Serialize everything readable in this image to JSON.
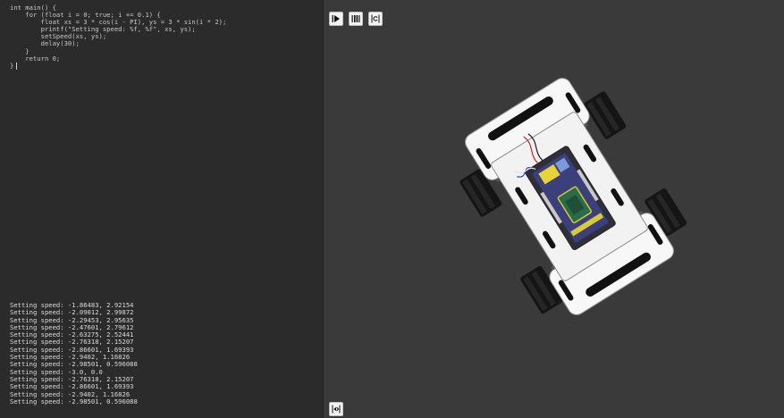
{
  "editor": {
    "code_lines": [
      "int main() {",
      "    for (float i = 0; true; i += 0.1) {",
      "        float xs = 3 * cos(i - PI), ys = 3 * sin(i * 2);",
      "        printf(\"Setting speed: %f, %f\", xs, ys);",
      "        setSpeed(xs, ys);",
      "        delay(30);",
      "    }",
      "    return 0;"
    ],
    "cursor_line": "}"
  },
  "console": {
    "lines": [
      "Setting speed: -1.86483, 2.92154",
      "Setting speed: -2.09012, 2.99872",
      "Setting speed: -2.29453, 2.95635",
      "Setting speed: -2.47601, 2.79612",
      "Setting speed: -2.63275, 2.52441",
      "Setting speed: -2.76318, 2.15207",
      "Setting speed: -2.86601, 1.69393",
      "Setting speed: -2.9402, 1.16826",
      "Setting speed: -2.98501, 0.596088",
      "Setting speed: -3.0, 0.0",
      "Setting speed: -2.76318, 2.15207",
      "Setting speed: -2.86601, 1.69393",
      "Setting speed: -2.9402, 1.16826",
      "Setting speed: -2.98501, 0.596088"
    ]
  },
  "toolbar": {
    "buttons": [
      {
        "icon": "play-icon"
      },
      {
        "icon": "pause-icon"
      },
      {
        "icon": "reset-icon"
      }
    ]
  },
  "bottom_toolbar": {
    "buttons": [
      {
        "icon": "view-code-icon"
      }
    ]
  },
  "colors": {
    "editor_bg": "#2b2b2b",
    "sim_bg": "#3a3a3a",
    "code_text": "#c8c8c8",
    "console_text": "#dcdcdc",
    "robot_chassis": "#ffffff",
    "wheel": "#1a1a1a",
    "pcb": "#2a6b4a"
  }
}
